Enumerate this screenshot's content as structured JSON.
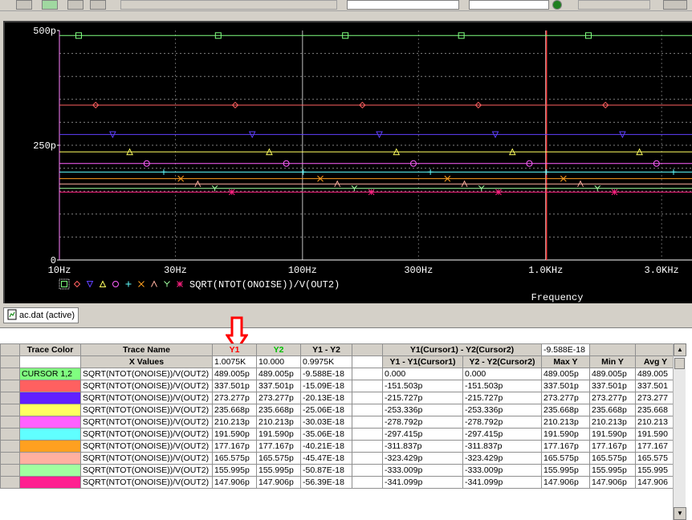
{
  "plot": {
    "y_ticks": [
      "500p",
      "250p",
      "0"
    ],
    "x_ticks": [
      "10Hz",
      "30Hz",
      "100Hz",
      "300Hz",
      "1.0KHz",
      "3.0KHz"
    ],
    "legend_expr": "SQRT(NTOT(ONOISE))/V(OUT2)",
    "xlabel": "Frequency"
  },
  "chart_data": {
    "type": "line",
    "xlabel": "Frequency",
    "ylabel": "",
    "x_scale": "log",
    "xlim": [
      10,
      4000
    ],
    "ylim": [
      0,
      5e-10
    ],
    "cursor1_x": 1007.5,
    "cursor2_x": 10.0,
    "series": [
      {
        "name": "SQRT(NTOT(ONOISE))/V(OUT2)",
        "marker": "square",
        "color": "#80ff80",
        "value": 4.89005e-10
      },
      {
        "name": "SQRT(NTOT(ONOISE))/V(OUT2)",
        "marker": "diamond",
        "color": "#ff6060",
        "value": 3.37501e-10
      },
      {
        "name": "SQRT(NTOT(ONOISE))/V(OUT2)",
        "marker": "triangle-down",
        "color": "#6040ff",
        "value": 2.73277e-10
      },
      {
        "name": "SQRT(NTOT(ONOISE))/V(OUT2)",
        "marker": "triangle",
        "color": "#ffff60",
        "value": 2.35668e-10
      },
      {
        "name": "SQRT(NTOT(ONOISE))/V(OUT2)",
        "marker": "circle",
        "color": "#ff60ff",
        "value": 2.10213e-10
      },
      {
        "name": "SQRT(NTOT(ONOISE))/V(OUT2)",
        "marker": "plus",
        "color": "#60ffff",
        "value": 1.9159e-10
      },
      {
        "name": "SQRT(NTOT(ONOISE))/V(OUT2)",
        "marker": "x",
        "color": "#ffa020",
        "value": 1.77167e-10
      },
      {
        "name": "SQRT(NTOT(ONOISE))/V(OUT2)",
        "marker": "lambda",
        "color": "#ffb0a0",
        "value": 1.65575e-10
      },
      {
        "name": "SQRT(NTOT(ONOISE))/V(OUT2)",
        "marker": "y",
        "color": "#a0ffa0",
        "value": 1.55995e-10
      },
      {
        "name": "SQRT(NTOT(ONOISE))/V(OUT2)",
        "marker": "star",
        "color": "#ff2080",
        "value": 1.47906e-10
      }
    ]
  },
  "tab": {
    "label": "ac.dat (active)"
  },
  "table": {
    "header1": {
      "trace_color": "Trace Color",
      "trace_name": "Trace Name",
      "y1": "Y1",
      "y2": "Y2",
      "diff": "Y1 - Y2",
      "cursor_diff": "Y1(Cursor1) - Y2(Cursor2)",
      "cursor_diff_value": "-9.588E-18"
    },
    "header2": {
      "x_values": "X Values",
      "x1": "1.0075K",
      "x2": "10.000",
      "xdiff": "0.9975K",
      "c1": "Y1 - Y1(Cursor1)",
      "c2": "Y2 - Y2(Cursor2)",
      "maxy": "Max Y",
      "miny": "Min Y",
      "avgy": "Avg Y"
    },
    "rows": [
      {
        "swatch": "#80ff80",
        "label": "CURSOR 1,2",
        "name": "SQRT(NTOT(ONOISE))/V(OUT2)",
        "y1": "489.005p",
        "y2": "489.005p",
        "diff": "-9.588E-18",
        "c1": "0.000",
        "c2": "0.000",
        "max": "489.005p",
        "min": "489.005p",
        "avg": "489.005"
      },
      {
        "swatch": "#ff6060",
        "label": "",
        "name": "SQRT(NTOT(ONOISE))/V(OUT2)",
        "y1": "337.501p",
        "y2": "337.501p",
        "diff": "-15.09E-18",
        "c1": "-151.503p",
        "c2": "-151.503p",
        "max": "337.501p",
        "min": "337.501p",
        "avg": "337.501"
      },
      {
        "swatch": "#6020ff",
        "label": "",
        "name": "SQRT(NTOT(ONOISE))/V(OUT2)",
        "y1": "273.277p",
        "y2": "273.277p",
        "diff": "-20.13E-18",
        "c1": "-215.727p",
        "c2": "-215.727p",
        "max": "273.277p",
        "min": "273.277p",
        "avg": "273.277"
      },
      {
        "swatch": "#ffff60",
        "label": "",
        "name": "SQRT(NTOT(ONOISE))/V(OUT2)",
        "y1": "235.668p",
        "y2": "235.668p",
        "diff": "-25.06E-18",
        "c1": "-253.336p",
        "c2": "-253.336p",
        "max": "235.668p",
        "min": "235.668p",
        "avg": "235.668"
      },
      {
        "swatch": "#ff60ff",
        "label": "",
        "name": "SQRT(NTOT(ONOISE))/V(OUT2)",
        "y1": "210.213p",
        "y2": "210.213p",
        "diff": "-30.03E-18",
        "c1": "-278.792p",
        "c2": "-278.792p",
        "max": "210.213p",
        "min": "210.213p",
        "avg": "210.213"
      },
      {
        "swatch": "#60ffff",
        "label": "",
        "name": "SQRT(NTOT(ONOISE))/V(OUT2)",
        "y1": "191.590p",
        "y2": "191.590p",
        "diff": "-35.06E-18",
        "c1": "-297.415p",
        "c2": "-297.415p",
        "max": "191.590p",
        "min": "191.590p",
        "avg": "191.590"
      },
      {
        "swatch": "#ffa020",
        "label": "",
        "name": "SQRT(NTOT(ONOISE))/V(OUT2)",
        "y1": "177.167p",
        "y2": "177.167p",
        "diff": "-40.21E-18",
        "c1": "-311.837p",
        "c2": "-311.837p",
        "max": "177.167p",
        "min": "177.167p",
        "avg": "177.167"
      },
      {
        "swatch": "#ffb0a0",
        "label": "",
        "name": "SQRT(NTOT(ONOISE))/V(OUT2)",
        "y1": "165.575p",
        "y2": "165.575p",
        "diff": "-45.47E-18",
        "c1": "-323.429p",
        "c2": "-323.429p",
        "max": "165.575p",
        "min": "165.575p",
        "avg": "165.575"
      },
      {
        "swatch": "#a0ffa0",
        "label": "",
        "name": "SQRT(NTOT(ONOISE))/V(OUT2)",
        "y1": "155.995p",
        "y2": "155.995p",
        "diff": "-50.87E-18",
        "c1": "-333.009p",
        "c2": "-333.009p",
        "max": "155.995p",
        "min": "155.995p",
        "avg": "155.995"
      },
      {
        "swatch": "#ff2090",
        "label": "",
        "name": "SQRT(NTOT(ONOISE))/V(OUT2)",
        "y1": "147.906p",
        "y2": "147.906p",
        "diff": "-56.39E-18",
        "c1": "-341.099p",
        "c2": "-341.099p",
        "max": "147.906p",
        "min": "147.906p",
        "avg": "147.906"
      }
    ]
  },
  "colors": {
    "y1": "#ff0000",
    "y2": "#00c000",
    "cursor_line": "#ff4040",
    "plot_bg": "#000000",
    "grid": "#ffffff",
    "axis_text": "#ffffff"
  }
}
